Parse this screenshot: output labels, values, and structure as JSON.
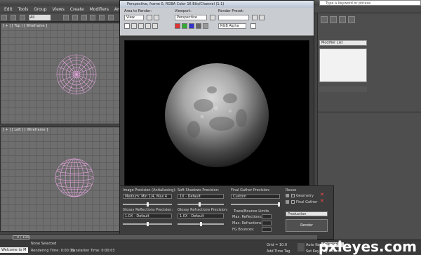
{
  "app": {
    "menu": [
      "Edit",
      "Tools",
      "Group",
      "Views",
      "Create",
      "Modifiers",
      "Anim"
    ],
    "selection_filter": "All",
    "search_placeholder": "Type a keyword or phrase"
  },
  "viewports": {
    "top": "[ + ] [ Top ] [ Wireframe ]",
    "left": "[ + ] [ Left ] [ Wireframe ]"
  },
  "command_panel": {
    "modifier_list": "Modifier List"
  },
  "render_window": {
    "title": "Perspective, frame 0, RGBA Color 16 Bits/Channel (1:1)",
    "area_label": "Area to Render:",
    "area_value": "View",
    "viewport_label": "Viewport:",
    "viewport_value": "Perspective",
    "preset_label": "Render Preset:",
    "preset_value": "",
    "channel_value": "RGB Alpha"
  },
  "render_setup": {
    "image_precision_label": "Image Precision (Antialiasing):",
    "image_precision_value": "Medium: Min 1/4, Max 4",
    "soft_shadows_label": "Soft Shadows Precision:",
    "soft_shadows_value": "1X - Default",
    "final_gather_label": "Final Gather Precision:",
    "final_gather_value": "Custom",
    "reuse_label": "Reuse",
    "geometry_label": "Geometry",
    "final_gather_check": "Final Gather",
    "glossy_reflections_label": "Glossy Reflections Precision:",
    "glossy_reflections_value": "1.0X - Default",
    "glossy_refractions_label": "Glossy Refractions Precision:",
    "glossy_refractions_value": "1.0X - Default",
    "trace_bounce_label": "Trace/Bounce Limits",
    "max_reflections_label": "Max. Reflections:",
    "max_refractions_label": "Max. Refractions:",
    "fg_bounces_label": "FG Bounces:",
    "production_value": "Production",
    "render_button": "Render"
  },
  "status": {
    "welcome": "Welcome to M",
    "selection": "None Selected",
    "render_time": "Rendering Time: 0:00:11",
    "translation_time": "Translation Time: 0:00:03",
    "grid": "Grid = 10.0",
    "add_time_tag": "Add Time Tag",
    "auto_key": "Auto Key",
    "selected": "Selected",
    "set_key": "Set Key",
    "key_filters": "Key Filters...",
    "timeline_value": "0 / 100"
  },
  "watermark": "pxleyes.com"
}
